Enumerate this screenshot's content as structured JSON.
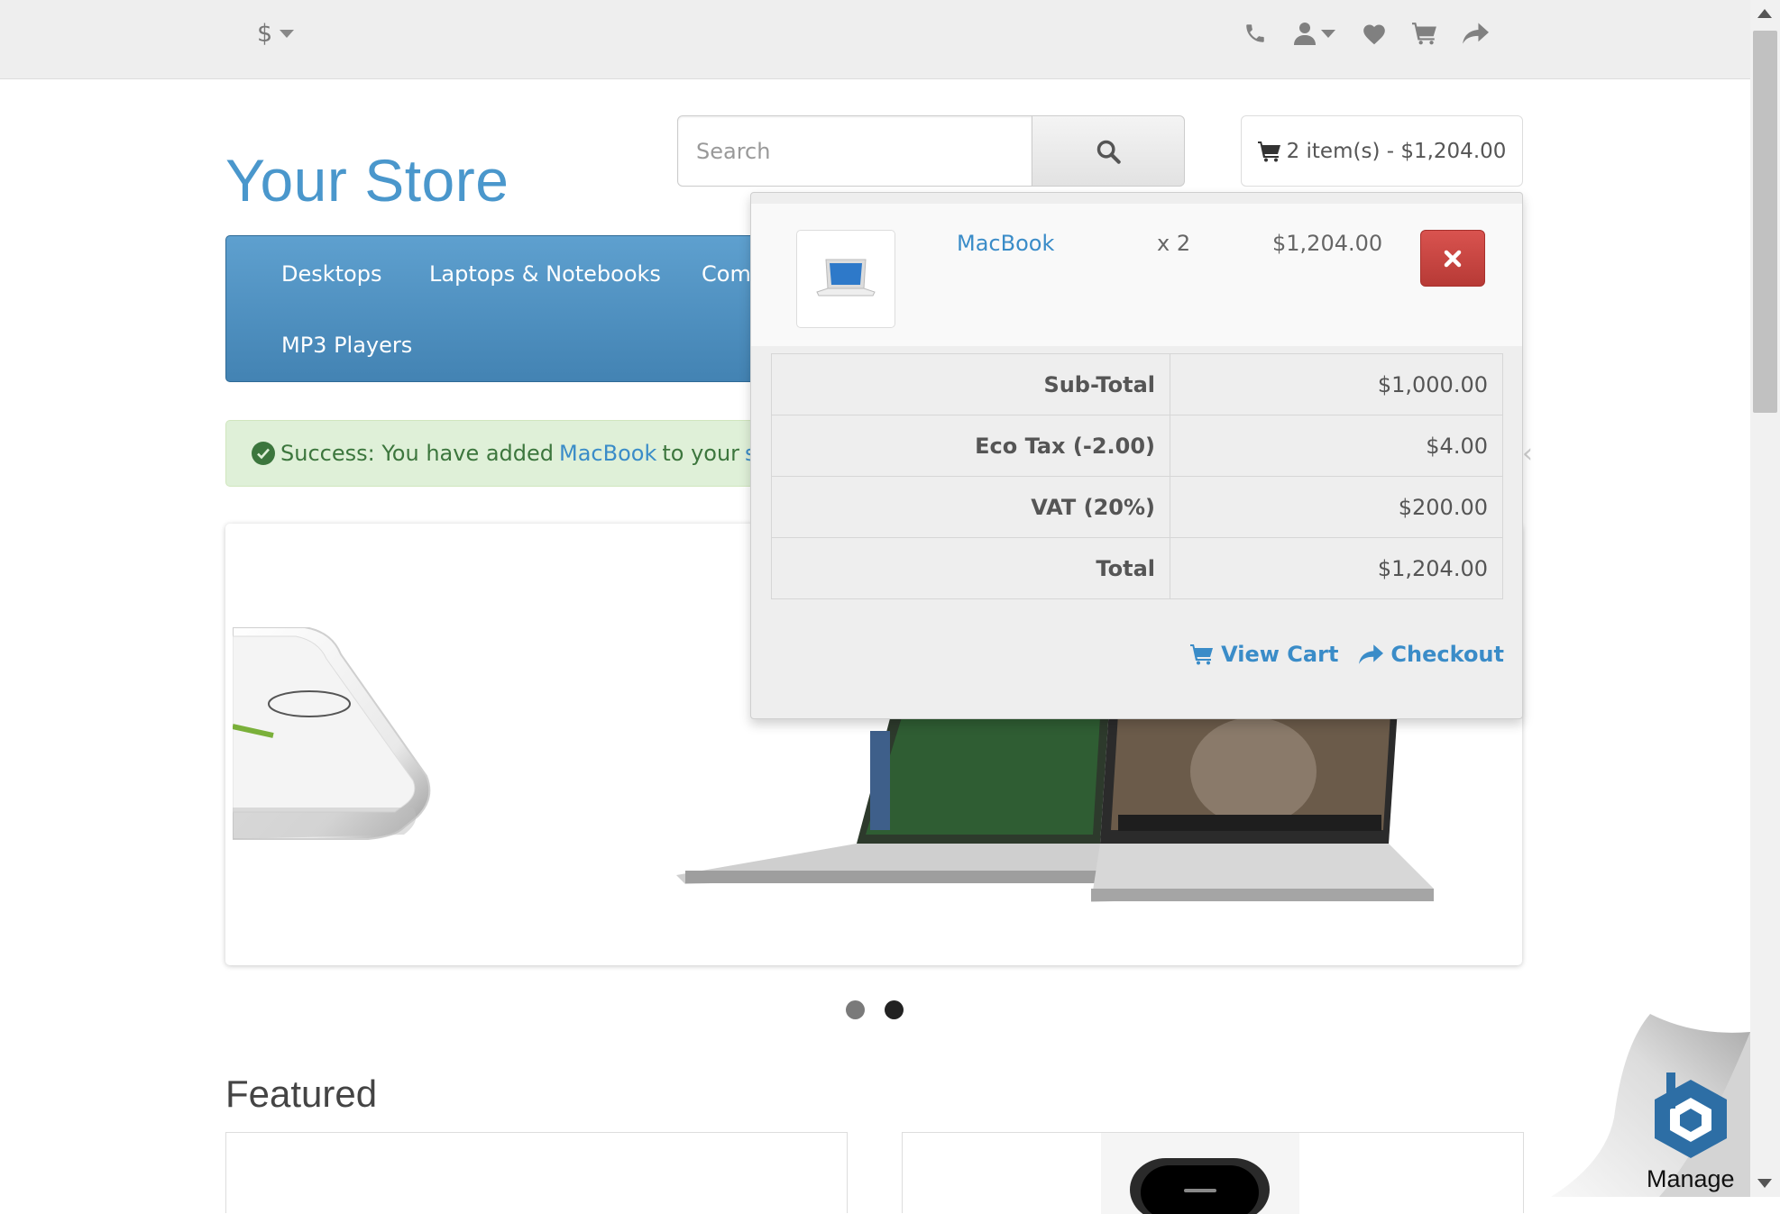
{
  "topbar": {
    "currency_symbol": "$",
    "icons": [
      "phone-icon",
      "user-icon",
      "heart-icon",
      "shopping-cart-icon",
      "share-icon"
    ]
  },
  "header": {
    "logo_text": "Your Store",
    "search": {
      "placeholder": "Search",
      "value": ""
    },
    "cart_button": "2 item(s) - $1,204.00"
  },
  "menu": {
    "items": [
      "Desktops",
      "Laptops & Notebooks",
      "Com",
      "MP3 Players"
    ]
  },
  "alert": {
    "prefix": "Success: You have added",
    "product_link": "MacBook",
    "middle": "to your",
    "cart_link": "sho"
  },
  "cart_dropdown": {
    "item": {
      "name": "MacBook",
      "qty": "x 2",
      "price": "$1,204.00"
    },
    "totals": [
      {
        "label": "Sub-Total",
        "value": "$1,000.00"
      },
      {
        "label": "Eco Tax (-2.00)",
        "value": "$4.00"
      },
      {
        "label": "VAT (20%)",
        "value": "$200.00"
      },
      {
        "label": "Total",
        "value": "$1,204.00"
      }
    ],
    "view_cart": "View Cart",
    "checkout": "Checkout"
  },
  "slideshow": {
    "dots": 2,
    "active_index": 1
  },
  "featured": {
    "title": "Featured"
  },
  "manage": {
    "label": "Manage"
  },
  "colors": {
    "brand_blue": "#4a97cc",
    "menu_blue": "#5193c4",
    "alert_green_bg": "#dff0d8",
    "danger_red": "#c9302c"
  }
}
